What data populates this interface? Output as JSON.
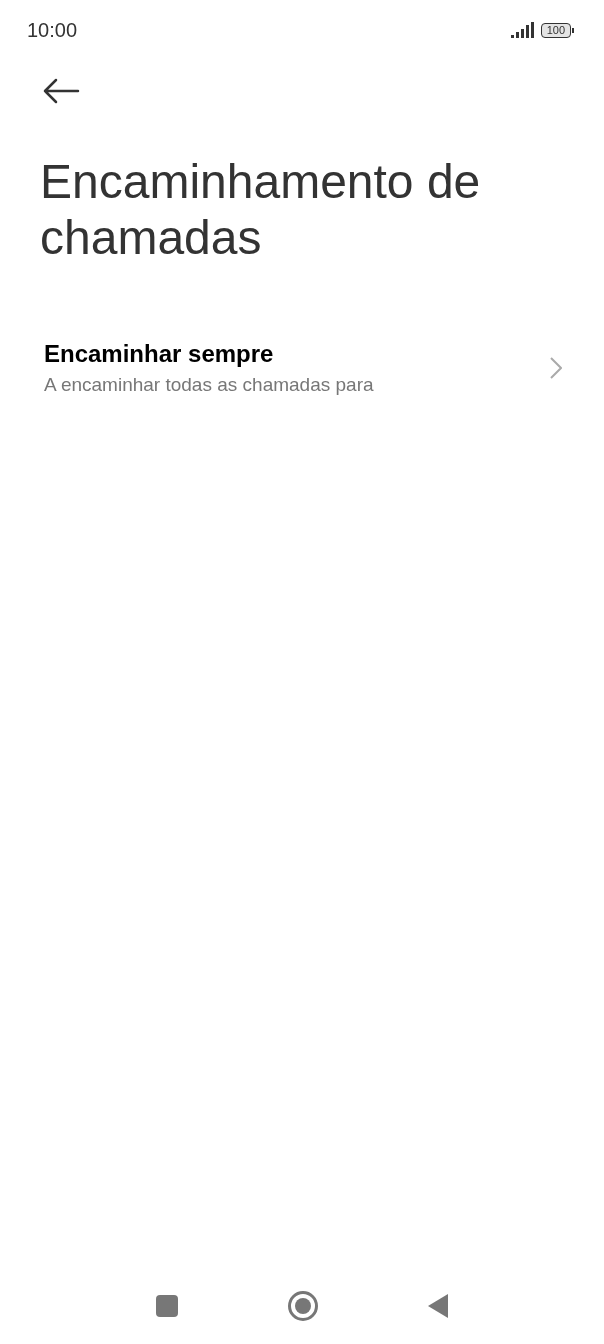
{
  "status_bar": {
    "time": "10:00",
    "battery": "100"
  },
  "title": "Encaminhamento de chamadas",
  "items": [
    {
      "title": "Encaminhar sempre",
      "subtitle": "A encaminhar todas as chamadas para"
    }
  ]
}
